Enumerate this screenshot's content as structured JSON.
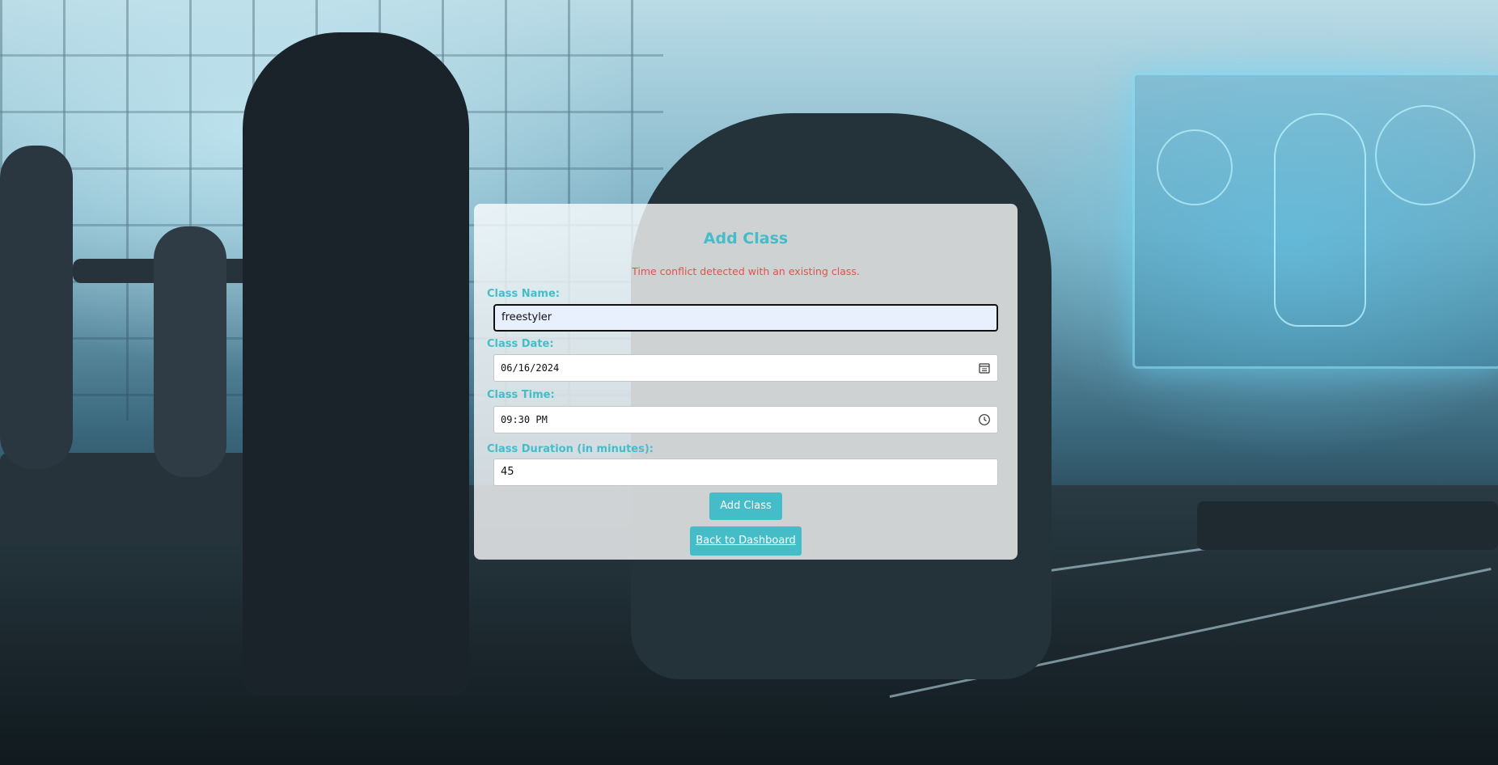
{
  "page": {
    "title": "Add Class",
    "error_message": "Time conflict detected with an existing class."
  },
  "form": {
    "class_name": {
      "label": "Class Name:",
      "value": "freestyler"
    },
    "class_date": {
      "label": "Class Date:",
      "value": "06/16/2024",
      "icon": "calendar-icon"
    },
    "class_time": {
      "label": "Class Time:",
      "value": "09:30 PM",
      "icon": "clock-icon"
    },
    "class_duration": {
      "label": "Class Duration (in minutes):",
      "value": "45"
    },
    "submit_label": "Add Class",
    "back_label": "Back to Dashboard"
  },
  "colors": {
    "accent": "#45bdc9",
    "error": "#ee4b4b",
    "focused_input_bg": "#e8f0fe"
  }
}
